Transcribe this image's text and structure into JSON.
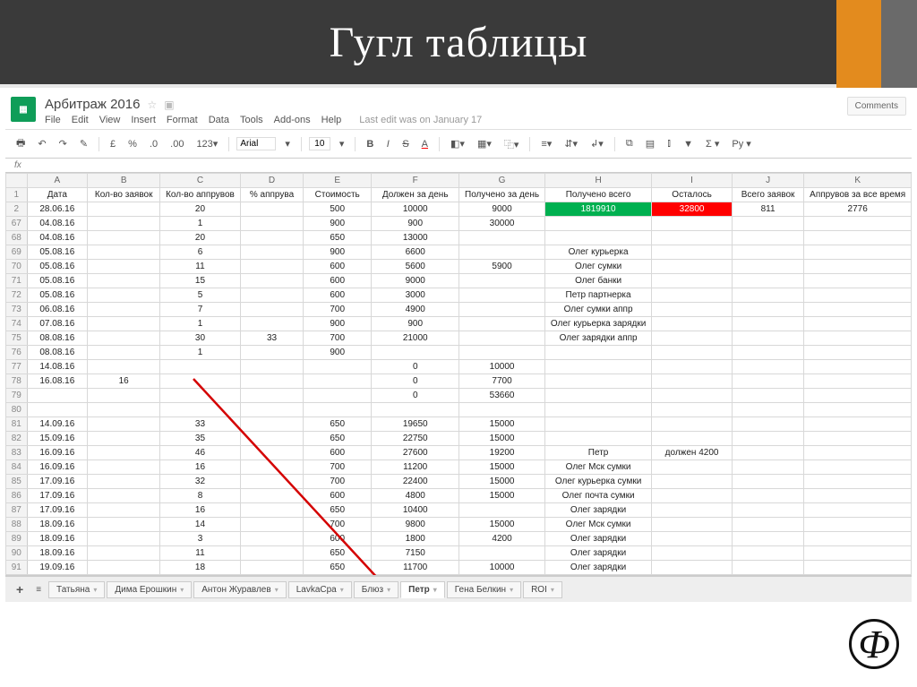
{
  "slide": {
    "title": "Гугл таблицы"
  },
  "doc": {
    "title": "Арбитраж 2016",
    "menu": [
      "File",
      "Edit",
      "View",
      "Insert",
      "Format",
      "Data",
      "Tools",
      "Add-ons",
      "Help"
    ],
    "last_edit": "Last edit was on January 17",
    "comments": "Comments"
  },
  "toolbar": {
    "font": "Arial",
    "size": "10"
  },
  "columns": [
    "",
    "A",
    "B",
    "C",
    "D",
    "E",
    "F",
    "G",
    "H",
    "I",
    "J",
    "K"
  ],
  "headers_row": {
    "num": "1",
    "A": "Дата",
    "B": "Кол-во заявок",
    "C": "Кол-во аппрувов",
    "D": "% аппрува",
    "E": "Стоимость",
    "F": "Должен за день",
    "G": "Получено за день",
    "H": "Получено всего",
    "I": "Осталось",
    "J": "Всего заявок",
    "K": "Аппрувов за все время"
  },
  "rows": [
    {
      "num": "2",
      "A": "28.06.16",
      "B": "",
      "C": "20",
      "D": "",
      "E": "500",
      "F": "10000",
      "G": "9000",
      "H": "1819910",
      "I": "32800",
      "J": "811",
      "K": "2776",
      "Hclass": "cell-green",
      "Iclass": "cell-red"
    },
    {
      "num": "67",
      "A": "04.08.16",
      "B": "",
      "C": "1",
      "D": "",
      "E": "900",
      "F": "900",
      "G": "30000",
      "H": "",
      "I": "",
      "J": "",
      "K": ""
    },
    {
      "num": "68",
      "A": "04.08.16",
      "B": "",
      "C": "20",
      "D": "",
      "E": "650",
      "F": "13000",
      "G": "",
      "H": "",
      "I": "",
      "J": "",
      "K": ""
    },
    {
      "num": "69",
      "A": "05.08.16",
      "B": "",
      "C": "6",
      "D": "",
      "E": "900",
      "F": "6600",
      "G": "",
      "H": "Олег курьерка",
      "I": "",
      "J": "",
      "K": ""
    },
    {
      "num": "70",
      "A": "05.08.16",
      "B": "",
      "C": "11",
      "D": "",
      "E": "600",
      "F": "5600",
      "G": "5900",
      "H": "Олег сумки",
      "I": "",
      "J": "",
      "K": ""
    },
    {
      "num": "71",
      "A": "05.08.16",
      "B": "",
      "C": "15",
      "D": "",
      "E": "600",
      "F": "9000",
      "G": "",
      "H": "Олег банки",
      "I": "",
      "J": "",
      "K": ""
    },
    {
      "num": "72",
      "A": "05.08.16",
      "B": "",
      "C": "5",
      "D": "",
      "E": "600",
      "F": "3000",
      "G": "",
      "H": "Петр партнерка",
      "I": "",
      "J": "",
      "K": ""
    },
    {
      "num": "73",
      "A": "06.08.16",
      "B": "",
      "C": "7",
      "D": "",
      "E": "700",
      "F": "4900",
      "G": "",
      "H": "Олег сумки аппр",
      "I": "",
      "J": "",
      "K": ""
    },
    {
      "num": "74",
      "A": "07.08.16",
      "B": "",
      "C": "1",
      "D": "",
      "E": "900",
      "F": "900",
      "G": "",
      "H": "Олег курьерка зарядки",
      "I": "",
      "J": "",
      "K": ""
    },
    {
      "num": "75",
      "A": "08.08.16",
      "B": "",
      "C": "30",
      "D": "33",
      "E": "700",
      "F": "21000",
      "G": "",
      "H": "Олег зарядки аппр",
      "I": "",
      "J": "",
      "K": ""
    },
    {
      "num": "76",
      "A": "08.08.16",
      "B": "",
      "C": "1",
      "D": "",
      "E": "900",
      "F": "",
      "G": "",
      "H": "",
      "I": "",
      "J": "",
      "K": ""
    },
    {
      "num": "77",
      "A": "14.08.16",
      "B": "",
      "C": "",
      "D": "",
      "E": "",
      "F": "0",
      "G": "10000",
      "H": "",
      "I": "",
      "J": "",
      "K": ""
    },
    {
      "num": "78",
      "A": "16.08.16",
      "B": "16",
      "C": "",
      "D": "",
      "E": "",
      "F": "0",
      "G": "7700",
      "H": "",
      "I": "",
      "J": "",
      "K": ""
    },
    {
      "num": "79",
      "A": "",
      "B": "",
      "C": "",
      "D": "",
      "E": "",
      "F": "0",
      "G": "53660",
      "H": "",
      "I": "",
      "J": "",
      "K": ""
    },
    {
      "num": "80",
      "A": "",
      "B": "",
      "C": "",
      "D": "",
      "E": "",
      "F": "",
      "G": "",
      "H": "",
      "I": "",
      "J": "",
      "K": ""
    },
    {
      "num": "81",
      "A": "14.09.16",
      "B": "",
      "C": "33",
      "D": "",
      "E": "650",
      "F": "19650",
      "G": "15000",
      "H": "",
      "I": "",
      "J": "",
      "K": ""
    },
    {
      "num": "82",
      "A": "15.09.16",
      "B": "",
      "C": "35",
      "D": "",
      "E": "650",
      "F": "22750",
      "G": "15000",
      "H": "",
      "I": "",
      "J": "",
      "K": ""
    },
    {
      "num": "83",
      "A": "16.09.16",
      "B": "",
      "C": "46",
      "D": "",
      "E": "600",
      "F": "27600",
      "G": "19200",
      "H": "Петр",
      "I": "должен 4200",
      "J": "",
      "K": ""
    },
    {
      "num": "84",
      "A": "16.09.16",
      "B": "",
      "C": "16",
      "D": "",
      "E": "700",
      "F": "11200",
      "G": "15000",
      "H": "Олег Мск сумки",
      "I": "",
      "J": "",
      "K": ""
    },
    {
      "num": "85",
      "A": "17.09.16",
      "B": "",
      "C": "32",
      "D": "",
      "E": "700",
      "F": "22400",
      "G": "15000",
      "H": "Олег   курьерка сумки",
      "I": "",
      "J": "",
      "K": ""
    },
    {
      "num": "86",
      "A": "17.09.16",
      "B": "",
      "C": "8",
      "D": "",
      "E": "600",
      "F": "4800",
      "G": "15000",
      "H": "Олег почта сумки",
      "I": "",
      "J": "",
      "K": ""
    },
    {
      "num": "87",
      "A": "17.09.16",
      "B": "",
      "C": "16",
      "D": "",
      "E": "650",
      "F": "10400",
      "G": "",
      "H": "Олег зарядки",
      "I": "",
      "J": "",
      "K": ""
    },
    {
      "num": "88",
      "A": "18.09.16",
      "B": "",
      "C": "14",
      "D": "",
      "E": "700",
      "F": "9800",
      "G": "15000",
      "H": "Олег Мск сумки",
      "I": "",
      "J": "",
      "K": ""
    },
    {
      "num": "89",
      "A": "18.09.16",
      "B": "",
      "C": "3",
      "D": "",
      "E": "600",
      "F": "1800",
      "G": "4200",
      "H": "Олег зарядки",
      "I": "",
      "J": "",
      "K": ""
    },
    {
      "num": "90",
      "A": "18.09.16",
      "B": "",
      "C": "11",
      "D": "",
      "E": "650",
      "F": "7150",
      "G": "",
      "H": "Олег зарядки",
      "I": "",
      "J": "",
      "K": ""
    },
    {
      "num": "91",
      "A": "19.09.16",
      "B": "",
      "C": "18",
      "D": "",
      "E": "650",
      "F": "11700",
      "G": "10000",
      "H": "Олег зарядки",
      "I": "",
      "J": "",
      "K": ""
    }
  ],
  "tabs": [
    "Татьяна",
    "Дима Ерошкин",
    "Антон Журавлев",
    "LavkaCpa",
    "Блюз",
    "Петр",
    "Гена Белкин",
    "ROI"
  ],
  "active_tab": "Петр",
  "watermark": "Ф"
}
